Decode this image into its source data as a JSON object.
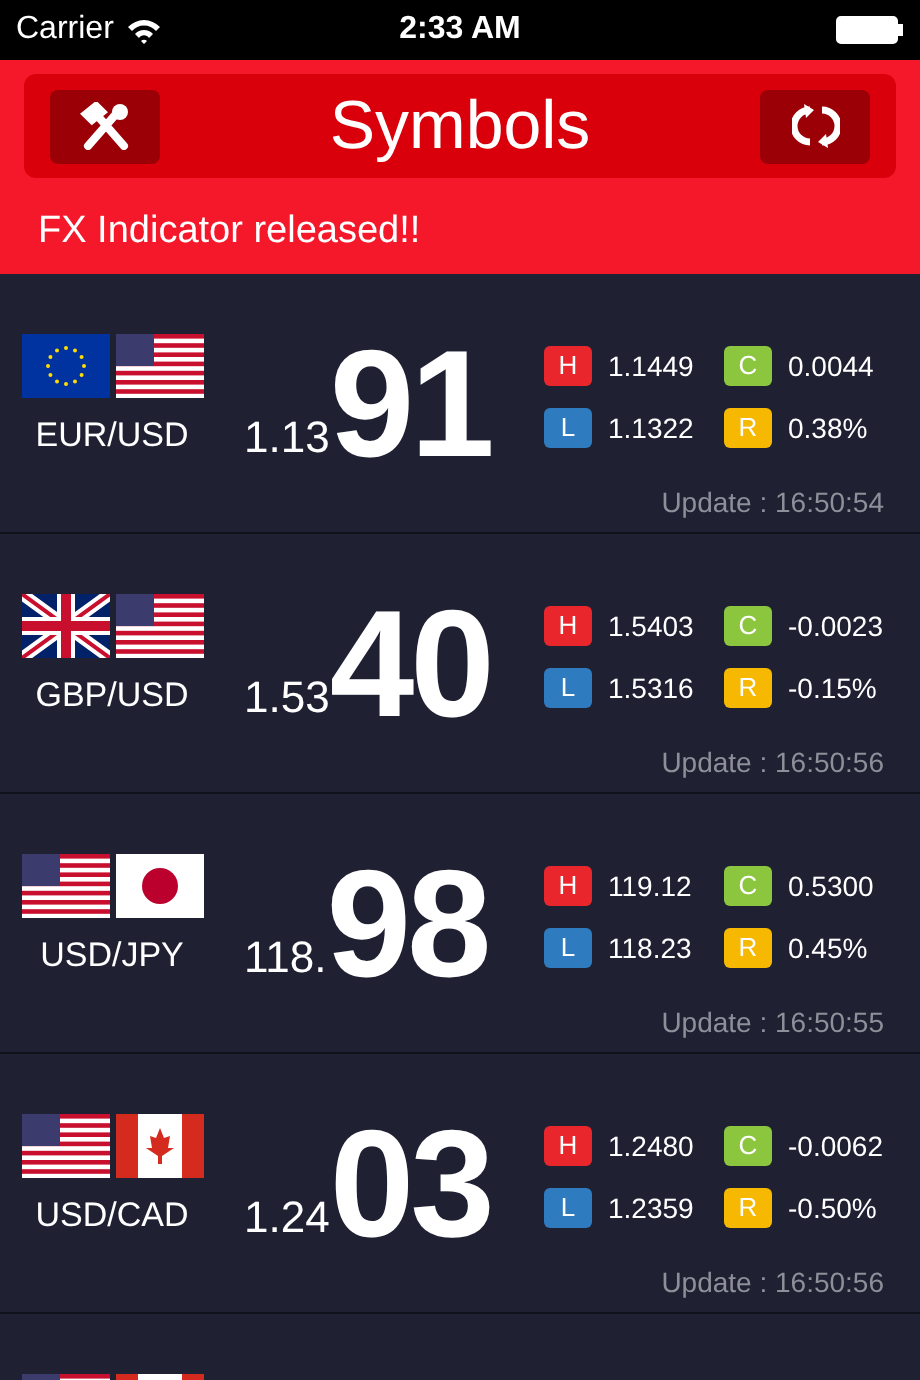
{
  "status_bar": {
    "carrier": "Carrier",
    "time": "2:33 AM"
  },
  "header": {
    "title": "Symbols",
    "banner": "FX Indicator released!!"
  },
  "rows": [
    {
      "flags": [
        {
          "kind": "eu"
        },
        {
          "kind": "us"
        }
      ],
      "pair": "EUR/USD",
      "price_small": "1.13",
      "price_big": "91",
      "indicators": [
        {
          "kind": "high",
          "badge": "H",
          "value": "1.1449"
        },
        {
          "kind": "change",
          "badge": "C",
          "value": "0.0044"
        },
        {
          "kind": "low",
          "badge": "L",
          "value": "1.1322"
        },
        {
          "kind": "rate",
          "badge": "R",
          "value": "0.38%"
        }
      ],
      "update": "Update : 16:50:54"
    },
    {
      "flags": [
        {
          "kind": "gb"
        },
        {
          "kind": "us"
        }
      ],
      "pair": "GBP/USD",
      "price_small": "1.53",
      "price_big": "40",
      "indicators": [
        {
          "kind": "high",
          "badge": "H",
          "value": "1.5403"
        },
        {
          "kind": "change",
          "badge": "C",
          "value": "-0.0023"
        },
        {
          "kind": "low",
          "badge": "L",
          "value": "1.5316"
        },
        {
          "kind": "rate",
          "badge": "R",
          "value": "-0.15%"
        }
      ],
      "update": "Update : 16:50:56"
    },
    {
      "flags": [
        {
          "kind": "us"
        },
        {
          "kind": "jp"
        }
      ],
      "pair": "USD/JPY",
      "price_small": "118.",
      "price_big": "98",
      "indicators": [
        {
          "kind": "high",
          "badge": "H",
          "value": "119.12"
        },
        {
          "kind": "change",
          "badge": "C",
          "value": "0.5300"
        },
        {
          "kind": "low",
          "badge": "L",
          "value": "118.23"
        },
        {
          "kind": "rate",
          "badge": "R",
          "value": "0.45%"
        }
      ],
      "update": "Update : 16:50:55"
    },
    {
      "flags": [
        {
          "kind": "us"
        },
        {
          "kind": "ca"
        }
      ],
      "pair": "USD/CAD",
      "price_small": "1.24",
      "price_big": "03",
      "indicators": [
        {
          "kind": "high",
          "badge": "H",
          "value": "1.2480"
        },
        {
          "kind": "change",
          "badge": "C",
          "value": "-0.0062"
        },
        {
          "kind": "low",
          "badge": "L",
          "value": "1.2359"
        },
        {
          "kind": "rate",
          "badge": "R",
          "value": "-0.50%"
        }
      ],
      "update": "Update : 16:50:56"
    },
    {
      "flags": [
        {
          "kind": "us"
        },
        {
          "kind": "ca"
        }
      ]
    }
  ]
}
